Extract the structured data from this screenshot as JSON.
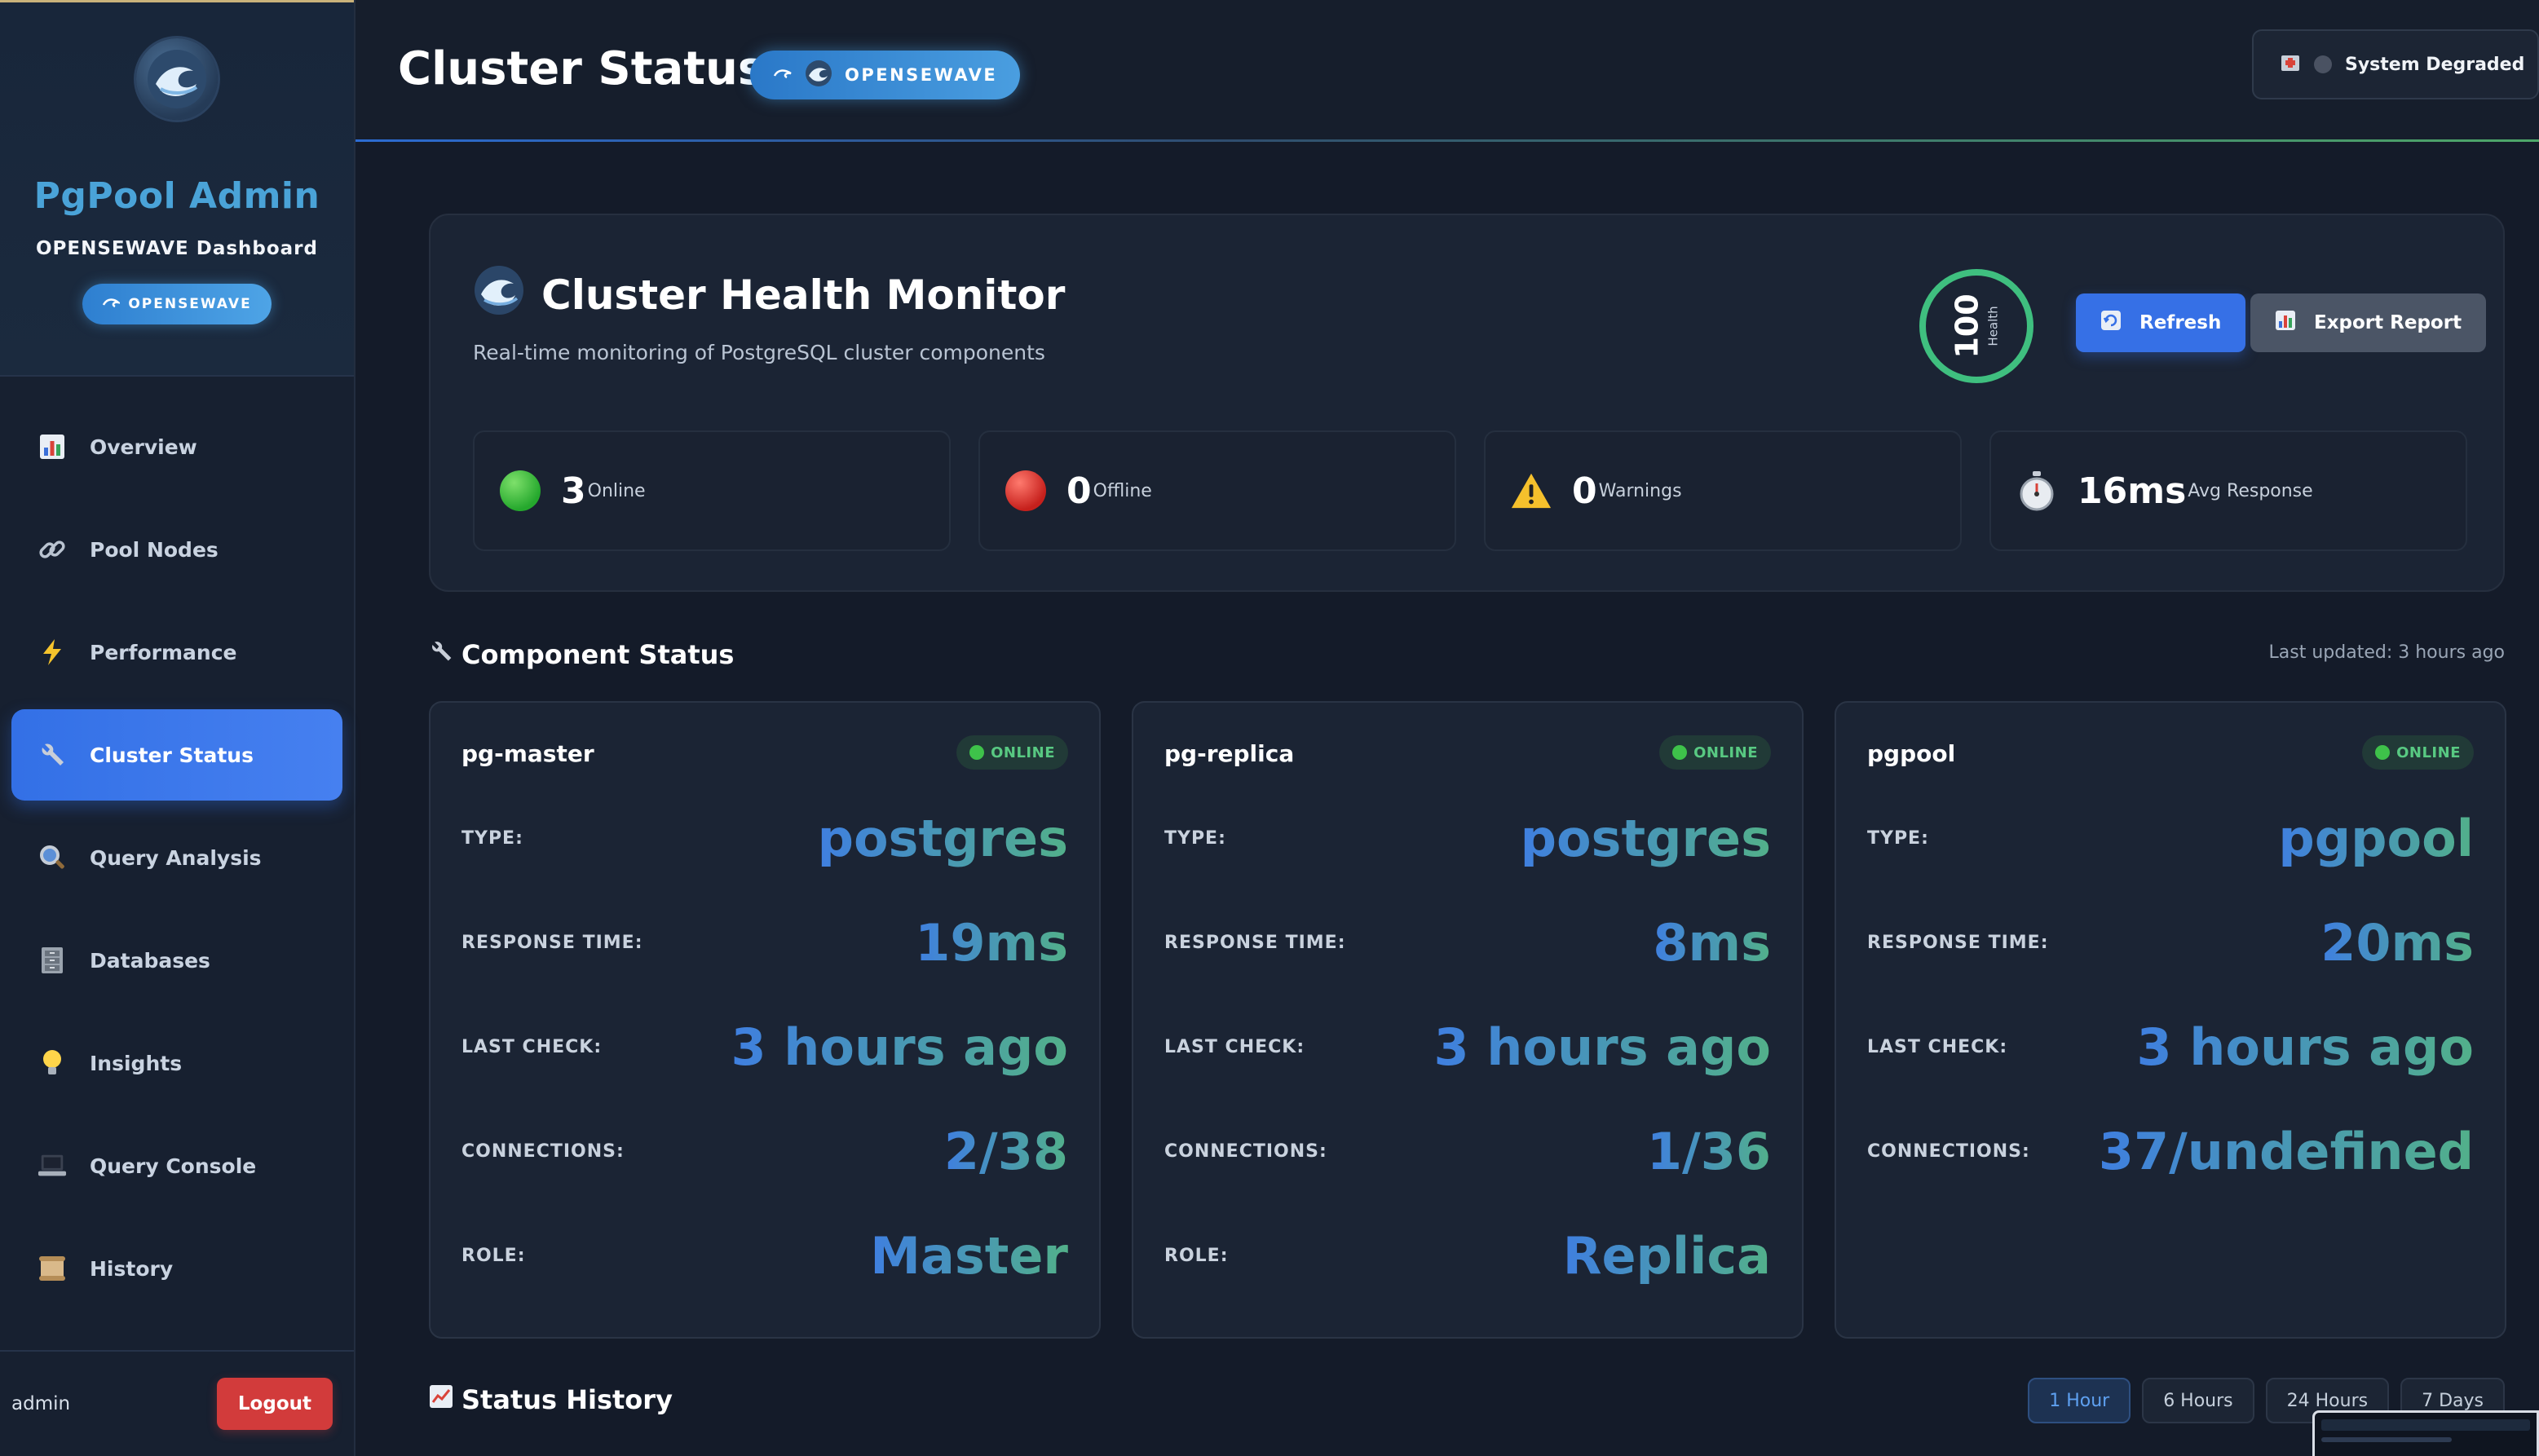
{
  "sidebar": {
    "app_title": "PgPool Admin",
    "subtitle": "OPENSEWAVE Dashboard",
    "badge": "OPENSEWAVE",
    "items": [
      {
        "label": "Overview",
        "icon": "bar-chart-icon"
      },
      {
        "label": "Pool Nodes",
        "icon": "link-icon"
      },
      {
        "label": "Performance",
        "icon": "lightning-icon"
      },
      {
        "label": "Cluster Status",
        "icon": "wrench-icon",
        "active": true
      },
      {
        "label": "Query Analysis",
        "icon": "magnifier-icon"
      },
      {
        "label": "Databases",
        "icon": "cabinet-icon"
      },
      {
        "label": "Insights",
        "icon": "lightbulb-icon"
      },
      {
        "label": "Query Console",
        "icon": "laptop-icon"
      },
      {
        "label": "History",
        "icon": "scroll-icon"
      }
    ],
    "user": "admin",
    "logout_label": "Logout"
  },
  "header": {
    "title": "Cluster Status",
    "badge": "OPENSEWAVE",
    "system_status": "System Degraded"
  },
  "health": {
    "title": "Cluster Health Monitor",
    "subtitle": "Real-time monitoring of PostgreSQL cluster components",
    "score": "100",
    "score_label": "Health",
    "refresh_label": "Refresh",
    "export_label": "Export Report",
    "stats": [
      {
        "value": "3",
        "label": "Online",
        "icon": "green-dot-icon"
      },
      {
        "value": "0",
        "label": "Offline",
        "icon": "red-dot-icon"
      },
      {
        "value": "0",
        "label": "Warnings",
        "icon": "warning-icon"
      },
      {
        "value": "16ms",
        "label": "Avg Response",
        "icon": "stopwatch-icon"
      }
    ]
  },
  "components": {
    "title": "Component Status",
    "last_updated": "Last updated: 3 hours ago",
    "labels": {
      "type": "TYPE:",
      "response_time": "RESPONSE TIME:",
      "last_check": "LAST CHECK:",
      "connections": "CONNECTIONS:",
      "role": "ROLE:"
    },
    "cards": [
      {
        "name": "pg-master",
        "status": "ONLINE",
        "type": "postgres",
        "response_time": "19ms",
        "last_check": "3 hours ago",
        "connections": "2/38",
        "role": "Master"
      },
      {
        "name": "pg-replica",
        "status": "ONLINE",
        "type": "postgres",
        "response_time": "8ms",
        "last_check": "3 hours ago",
        "connections": "1/36",
        "role": "Replica"
      },
      {
        "name": "pgpool",
        "status": "ONLINE",
        "type": "pgpool",
        "response_time": "20ms",
        "last_check": "3 hours ago",
        "connections": "37/undefined"
      }
    ]
  },
  "history": {
    "title": "Status History",
    "ranges": [
      "1 Hour",
      "6 Hours",
      "24 Hours",
      "7 Days"
    ],
    "active_range": "1 Hour"
  },
  "colors": {
    "accent": "#3670e6",
    "online": "#3ec24a",
    "offline": "#c6201c",
    "logout": "#d23b3b"
  }
}
